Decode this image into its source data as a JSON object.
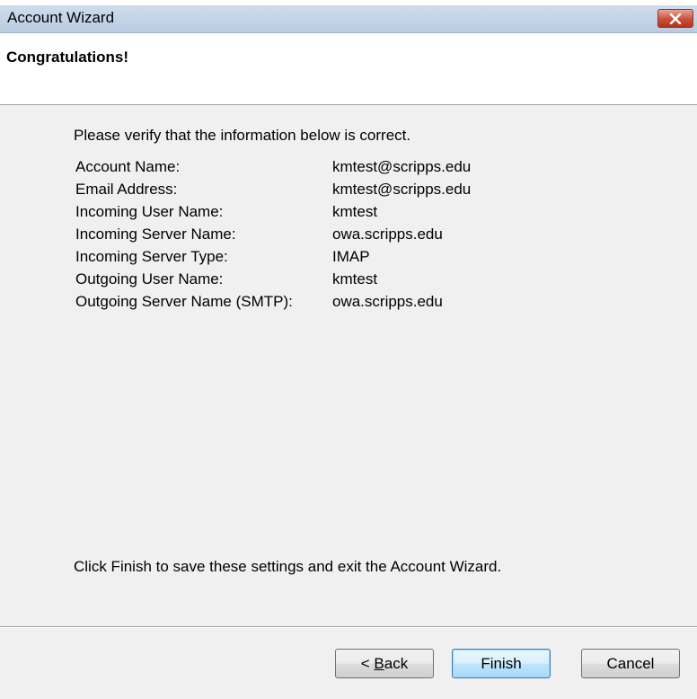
{
  "window": {
    "title": "Account Wizard"
  },
  "header": {
    "title": "Congratulations!"
  },
  "main": {
    "intro": "Please verify that the information below is correct.",
    "fields": [
      {
        "label": "Account Name:",
        "value": "kmtest@scripps.edu"
      },
      {
        "label": "Email Address:",
        "value": "kmtest@scripps.edu"
      },
      {
        "label": "Incoming User Name:",
        "value": "kmtest"
      },
      {
        "label": "Incoming Server Name:",
        "value": "owa.scripps.edu"
      },
      {
        "label": "Incoming Server Type:",
        "value": "IMAP"
      },
      {
        "label": "Outgoing User Name:",
        "value": "kmtest"
      },
      {
        "label": "Outgoing Server Name (SMTP):",
        "value": "owa.scripps.edu"
      }
    ],
    "note": "Click Finish to save these settings and exit the Account Wizard."
  },
  "footer": {
    "back_prefix": "< ",
    "back_accel": "B",
    "back_rest": "ack",
    "finish_label": "Finish",
    "cancel_label": "Cancel"
  },
  "icons": {
    "close": "close-icon"
  },
  "colors": {
    "titlebar": "#c4d4e8",
    "close_button": "#c9503a",
    "content_bg": "#f0f0f0",
    "default_button_border": "#3c7fb1"
  }
}
